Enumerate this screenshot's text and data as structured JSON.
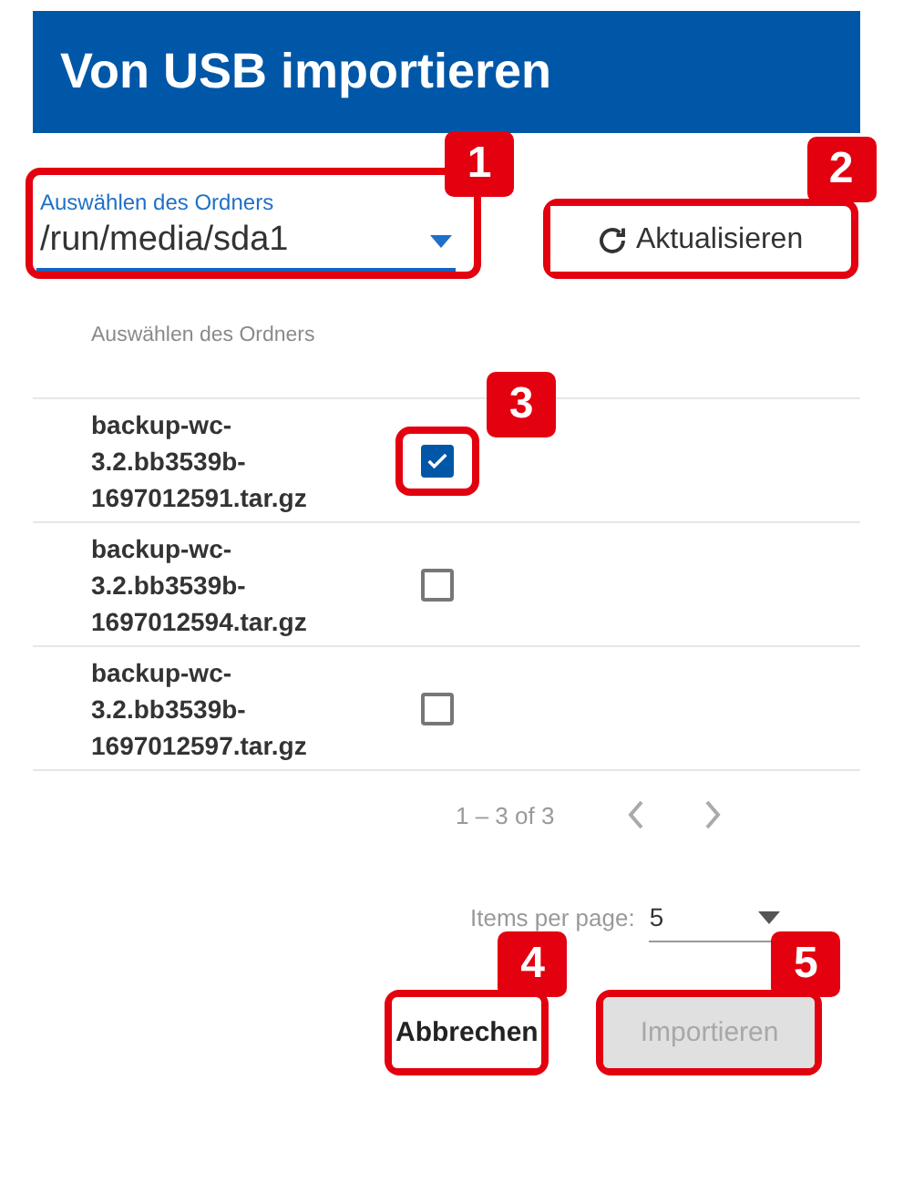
{
  "title": "Von USB importieren",
  "folder_select": {
    "label": "Auswählen des Ordners",
    "value": "/run/media/sda1",
    "callout": "1"
  },
  "refresh_button": {
    "label": "Aktualisieren",
    "callout": "2"
  },
  "table": {
    "column_header": "Auswählen des Ordners",
    "rows": [
      {
        "name": "backup-wc-3.2.bb3539b-1697012591.tar.gz",
        "checked": true,
        "callout": "3"
      },
      {
        "name": "backup-wc-3.2.bb3539b-1697012594.tar.gz",
        "checked": false
      },
      {
        "name": "backup-wc-3.2.bb3539b-1697012597.tar.gz",
        "checked": false
      }
    ]
  },
  "pagination": {
    "range": "1 – 3 of 3",
    "items_per_page_label": "Items per page:",
    "items_per_page_value": "5"
  },
  "buttons": [
    {
      "label": "Abbrechen",
      "disabled": false,
      "callout": "4"
    },
    {
      "label": "Importieren",
      "disabled": true,
      "callout": "5"
    }
  ]
}
